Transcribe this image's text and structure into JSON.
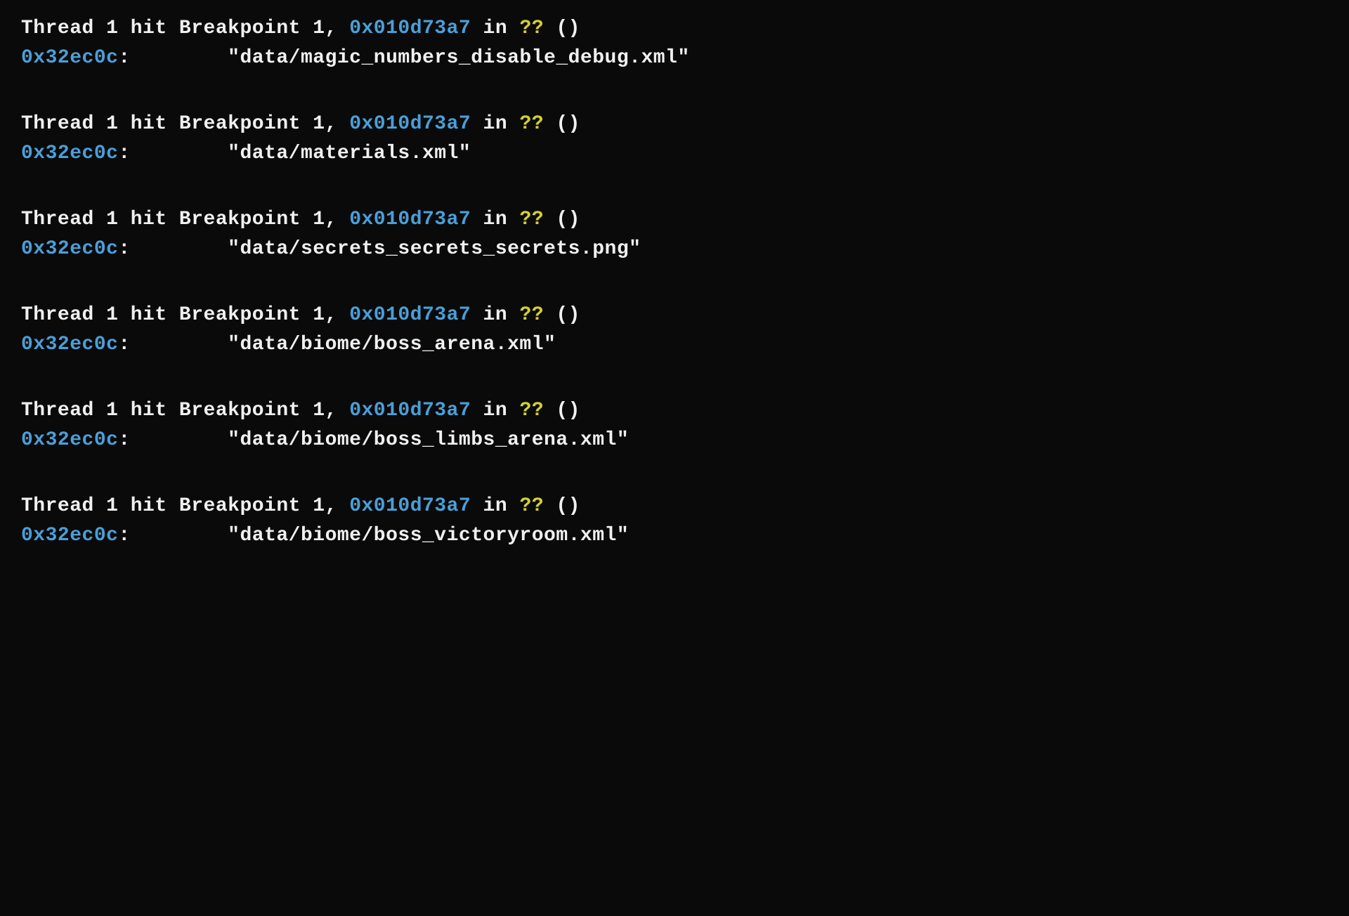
{
  "breakpoints": [
    {
      "thread_prefix": "Thread 1 hit Breakpoint 1, ",
      "addr": "0x010d73a7",
      "in_text": " in ",
      "unknown": "??",
      "paren": " ()",
      "mem_addr": "0x32ec0c",
      "colon_space": ":        ",
      "value": "\"data/magic_numbers_disable_debug.xml\""
    },
    {
      "thread_prefix": "Thread 1 hit Breakpoint 1, ",
      "addr": "0x010d73a7",
      "in_text": " in ",
      "unknown": "??",
      "paren": " ()",
      "mem_addr": "0x32ec0c",
      "colon_space": ":        ",
      "value": "\"data/materials.xml\""
    },
    {
      "thread_prefix": "Thread 1 hit Breakpoint 1, ",
      "addr": "0x010d73a7",
      "in_text": " in ",
      "unknown": "??",
      "paren": " ()",
      "mem_addr": "0x32ec0c",
      "colon_space": ":        ",
      "value": "\"data/secrets_secrets_secrets.png\""
    },
    {
      "thread_prefix": "Thread 1 hit Breakpoint 1, ",
      "addr": "0x010d73a7",
      "in_text": " in ",
      "unknown": "??",
      "paren": " ()",
      "mem_addr": "0x32ec0c",
      "colon_space": ":        ",
      "value": "\"data/biome/boss_arena.xml\""
    },
    {
      "thread_prefix": "Thread 1 hit Breakpoint 1, ",
      "addr": "0x010d73a7",
      "in_text": " in ",
      "unknown": "??",
      "paren": " ()",
      "mem_addr": "0x32ec0c",
      "colon_space": ":        ",
      "value": "\"data/biome/boss_limbs_arena.xml\""
    },
    {
      "thread_prefix": "Thread 1 hit Breakpoint 1, ",
      "addr": "0x010d73a7",
      "in_text": " in ",
      "unknown": "??",
      "paren": " ()",
      "mem_addr": "0x32ec0c",
      "colon_space": ":        ",
      "value": "\"data/biome/boss_victoryroom.xml\""
    }
  ]
}
